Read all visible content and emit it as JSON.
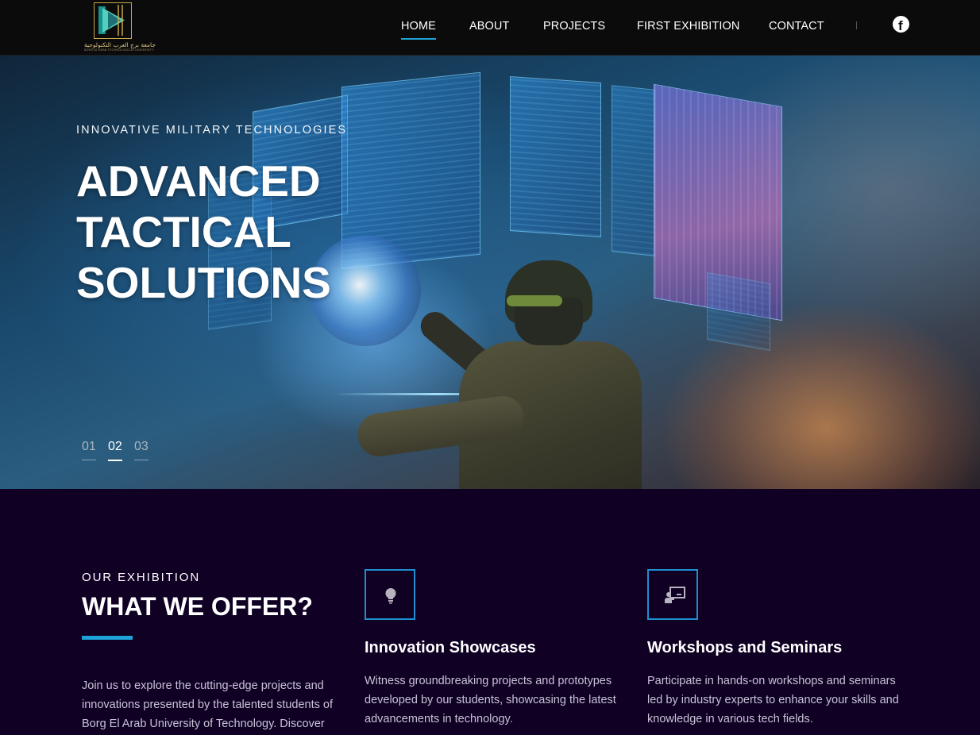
{
  "nav": {
    "logo": {
      "arabic_name": "جامعة برج العرب التكنولوجية",
      "english_name": "BORG AL ARAB TECHNOLOGICAL UNIVERSITY"
    },
    "links": [
      {
        "label": "HOME",
        "active": true
      },
      {
        "label": "ABOUT",
        "active": false
      },
      {
        "label": "PROJECTS",
        "active": false
      },
      {
        "label": "FIRST EXHIBITION",
        "active": false
      },
      {
        "label": "CONTACT",
        "active": false
      }
    ],
    "social_icon": "facebook-icon",
    "social_glyph": "f"
  },
  "hero": {
    "subtitle": "INNOVATIVE MILITARY TECHNOLOGIES",
    "title": "ADVANCED TACTICAL SOLUTIONS",
    "slides": [
      "01",
      "02",
      "03"
    ],
    "active_slide": "02"
  },
  "offer": {
    "label": "OUR EXHIBITION",
    "title": "WHAT WE OFFER?",
    "text": "Join us to explore the cutting-edge projects and innovations presented by the talented students of Borg El Arab University of Technology. Discover",
    "cards": [
      {
        "icon": "lightbulb-icon",
        "title": "Innovation Showcases",
        "text": "Witness groundbreaking projects and prototypes developed by our students, showcasing the latest advancements in technology."
      },
      {
        "icon": "presentation-icon",
        "title": "Workshops and Seminars",
        "text": "Participate in hands-on workshops and seminars led by industry experts to enhance your skills and knowledge in various tech fields."
      }
    ]
  },
  "colors": {
    "accent": "#1ea3d8",
    "nav_bg": "#0b0b0b",
    "section_bg": "#0f0024",
    "logo_gold": "#c9a84a"
  }
}
